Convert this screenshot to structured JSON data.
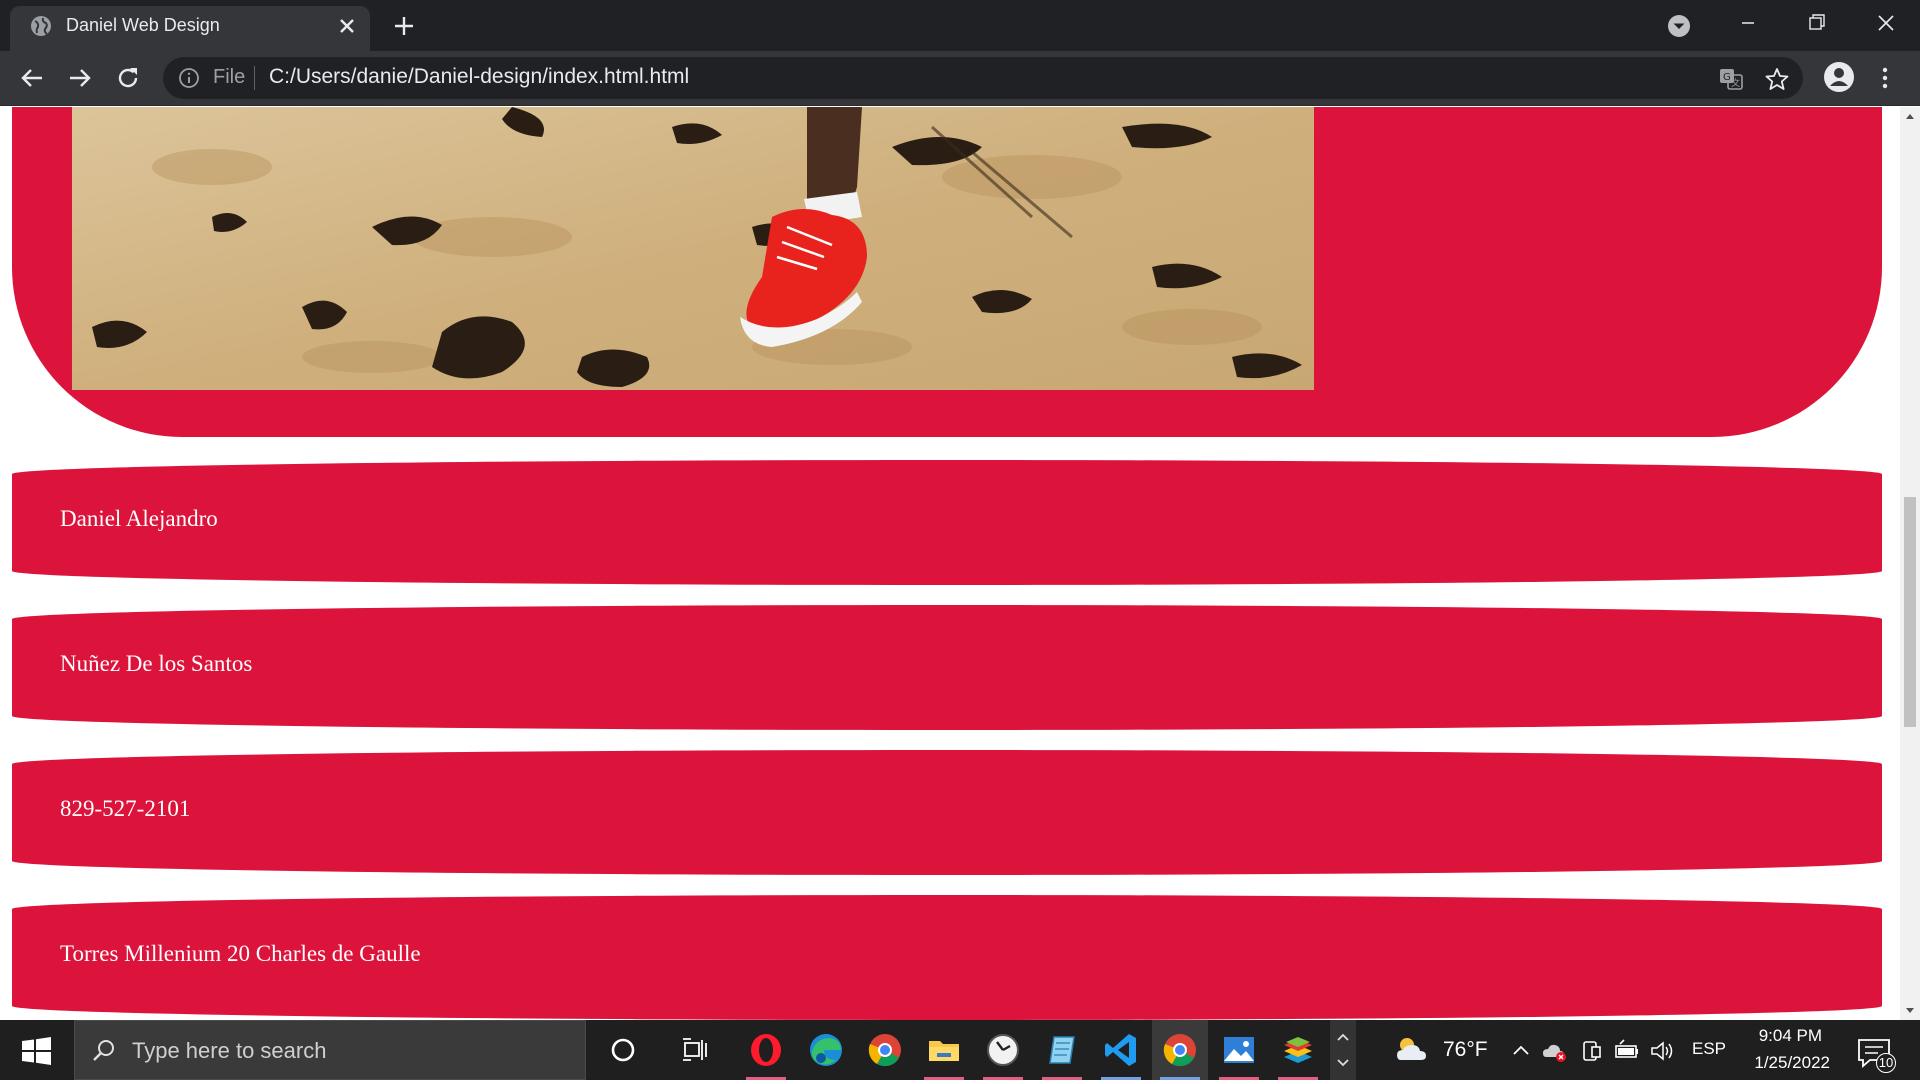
{
  "browser": {
    "tab_title": "Daniel Web Design",
    "address_scheme_label": "File",
    "address_url": "C:/Users/danie/Daniel-design/index.html.html"
  },
  "page": {
    "accent_color": "#dc143c",
    "hero_image": "runner-on-sand-red-sneaker",
    "info_rows": [
      "Daniel Alejandro",
      "Nuñez De los Santos",
      "829-527-2101",
      "Torres Millenium 20 Charles de Gaulle"
    ]
  },
  "taskbar": {
    "search_placeholder": "Type here to search",
    "apps": [
      "cortana-icon",
      "task-view-icon",
      "opera-icon",
      "edge-icon",
      "chrome-icon",
      "file-explorer-icon",
      "clock-app-icon",
      "notepad-icon",
      "vscode-icon",
      "chrome-active-icon",
      "photos-icon",
      "bluestacks-icon"
    ],
    "weather_temp": "76°F",
    "language": "ESP",
    "time": "9:04 PM",
    "date": "1/25/2022",
    "notification_count": "10"
  }
}
